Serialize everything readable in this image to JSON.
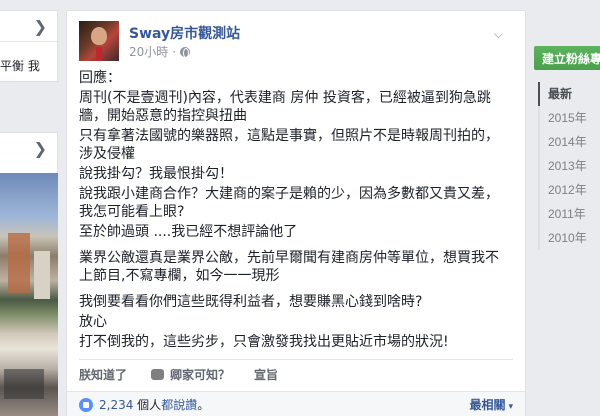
{
  "left_panel": {
    "card1_text": "平衡 我"
  },
  "post": {
    "page_name": "Sway房市觀測站",
    "timestamp": "20小時",
    "body": [
      "回應：",
      "周刊(不是壹週刊)內容，代表建商 房仲 投資客，已經被逼到狗急跳牆，開始惡意的指控與扭曲",
      "只有拿著法國號的樂器照，這點是事實，但照片不是時報周刊拍的，涉及侵權",
      "說我掛勾？我最恨掛勾！",
      "說我跟小建商合作？大建商的案子是賴的少，因為多數都又貴又差，我怎可能看上眼?",
      "至於帥過頭 ....我已經不想評論他了",
      "業界公敵還真是業界公敵，先前早爾聞有建商房仲等單位，想買我不上節目,不寫專欄，如今一一現形",
      "我倒要看看你們這些既得利益者，想要賺黑心錢到啥時?",
      "放心",
      "打不倒我的，這些劣步，只會激發我找出更貼近市場的狀況!"
    ],
    "actions": {
      "like": "朕知道了",
      "comment": "卿家可知？",
      "share": "宣旨"
    },
    "stats": {
      "count": "2,234",
      "suffix_prefix": " 個人",
      "suffix_link": "都說讚",
      "suffix_end": "。",
      "sort_label": "最相關"
    }
  },
  "sidebar": {
    "cta_label": "建立粉絲專頁",
    "timeline": [
      "最新",
      "2015年",
      "2014年",
      "2013年",
      "2012年",
      "2011年",
      "2010年"
    ]
  },
  "colors": {
    "link_blue": "#365899",
    "cta_green": "#4caf50",
    "like_blue": "#5890ff"
  }
}
